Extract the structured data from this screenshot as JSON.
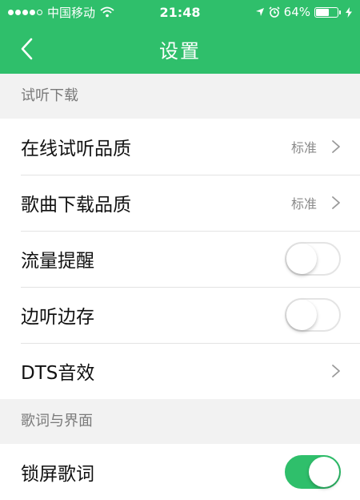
{
  "status_bar": {
    "carrier": "中国移动",
    "time": "21:48",
    "battery_percent": "64%",
    "battery_level": 0.64,
    "icons": [
      "signal-dots-icon",
      "wifi-icon",
      "location-arrow-icon",
      "alarm-icon",
      "battery-icon",
      "charging-icon"
    ]
  },
  "nav": {
    "title": "设置",
    "back_icon": "chevron-left-icon"
  },
  "sections": [
    {
      "header": "试听下载",
      "rows": [
        {
          "label": "在线试听品质",
          "value": "标准",
          "control": "chevron"
        },
        {
          "label": "歌曲下载品质",
          "value": "标准",
          "control": "chevron"
        },
        {
          "label": "流量提醒",
          "control": "toggle",
          "on": false
        },
        {
          "label": "边听边存",
          "control": "toggle",
          "on": false
        },
        {
          "label": "DTS音效",
          "control": "chevron"
        }
      ]
    },
    {
      "header": "歌词与界面",
      "rows": [
        {
          "label": "锁屏歌词",
          "control": "toggle",
          "on": true
        }
      ]
    }
  ],
  "colors": {
    "brand_green": "#2fbf6b",
    "section_bg": "#f2f2f2",
    "secondary_text": "#8a8a8a"
  }
}
